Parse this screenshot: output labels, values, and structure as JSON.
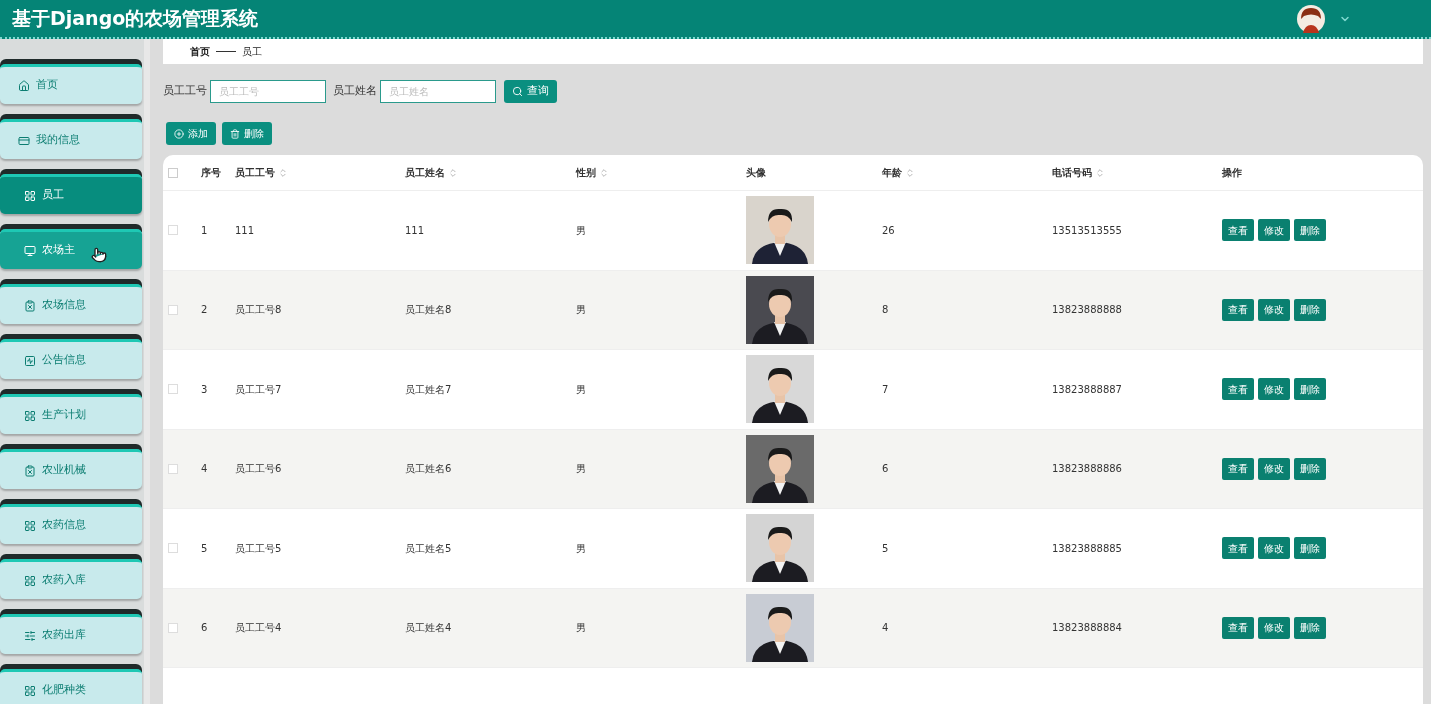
{
  "header": {
    "title": "基于Django的农场管理系统"
  },
  "sidebar": {
    "items": [
      {
        "label": "首页",
        "kind": "home",
        "selected": false,
        "hovered": false
      },
      {
        "label": "我的信息",
        "kind": "card",
        "selected": false,
        "hovered": false
      },
      {
        "label": "员工",
        "kind": "grid",
        "selected": true,
        "hovered": false
      },
      {
        "label": "农场主",
        "kind": "monitor",
        "selected": false,
        "hovered": true
      },
      {
        "label": "农场信息",
        "kind": "clipboard",
        "selected": false,
        "hovered": false
      },
      {
        "label": "公告信息",
        "kind": "chart",
        "selected": false,
        "hovered": false
      },
      {
        "label": "生产计划",
        "kind": "grid",
        "selected": false,
        "hovered": false
      },
      {
        "label": "农业机械",
        "kind": "clipboard",
        "selected": false,
        "hovered": false
      },
      {
        "label": "农药信息",
        "kind": "grid",
        "selected": false,
        "hovered": false
      },
      {
        "label": "农药入库",
        "kind": "grid",
        "selected": false,
        "hovered": false
      },
      {
        "label": "农药出库",
        "kind": "sliders",
        "selected": false,
        "hovered": false
      },
      {
        "label": "化肥种类",
        "kind": "grid",
        "selected": false,
        "hovered": false
      }
    ]
  },
  "breadcrumb": [
    "首页",
    "员工"
  ],
  "search": {
    "fields": [
      {
        "label": "员工工号",
        "placeholder": "员工工号"
      },
      {
        "label": "员工姓名",
        "placeholder": "员工姓名"
      }
    ],
    "button": "查询"
  },
  "actions": [
    {
      "label": "添加",
      "kind": "add"
    },
    {
      "label": "删除",
      "kind": "delete"
    }
  ],
  "table": {
    "all_checked": false,
    "columns": [
      {
        "label": "序号",
        "sortable": false
      },
      {
        "label": "员工工号",
        "sortable": true
      },
      {
        "label": "员工姓名",
        "sortable": true
      },
      {
        "label": "性别",
        "sortable": true
      },
      {
        "label": "头像",
        "sortable": false
      },
      {
        "label": "年龄",
        "sortable": true
      },
      {
        "label": "电话号码",
        "sortable": true
      },
      {
        "label": "操作",
        "sortable": false
      }
    ],
    "rows": [
      {
        "index": "1",
        "id": "111",
        "name": "111",
        "gender": "男",
        "age": "26",
        "phone": "13513513555",
        "checked": false,
        "actions": [
          "查看",
          "修改",
          "删除"
        ]
      },
      {
        "index": "2",
        "id": "员工工号8",
        "name": "员工姓名8",
        "gender": "男",
        "age": "8",
        "phone": "13823888888",
        "checked": false,
        "actions": [
          "查看",
          "修改",
          "删除"
        ]
      },
      {
        "index": "3",
        "id": "员工工号7",
        "name": "员工姓名7",
        "gender": "男",
        "age": "7",
        "phone": "13823888887",
        "checked": false,
        "actions": [
          "查看",
          "修改",
          "删除"
        ]
      },
      {
        "index": "4",
        "id": "员工工号6",
        "name": "员工姓名6",
        "gender": "男",
        "age": "6",
        "phone": "13823888886",
        "checked": false,
        "actions": [
          "查看",
          "修改",
          "删除"
        ]
      },
      {
        "index": "5",
        "id": "员工工号5",
        "name": "员工姓名5",
        "gender": "男",
        "age": "5",
        "phone": "13823888885",
        "checked": false,
        "actions": [
          "查看",
          "修改",
          "删除"
        ]
      },
      {
        "index": "6",
        "id": "员工工号4",
        "name": "员工姓名4",
        "gender": "男",
        "age": "4",
        "phone": "13823888884",
        "checked": false,
        "actions": [
          "查看",
          "修改",
          "删除"
        ]
      }
    ]
  }
}
